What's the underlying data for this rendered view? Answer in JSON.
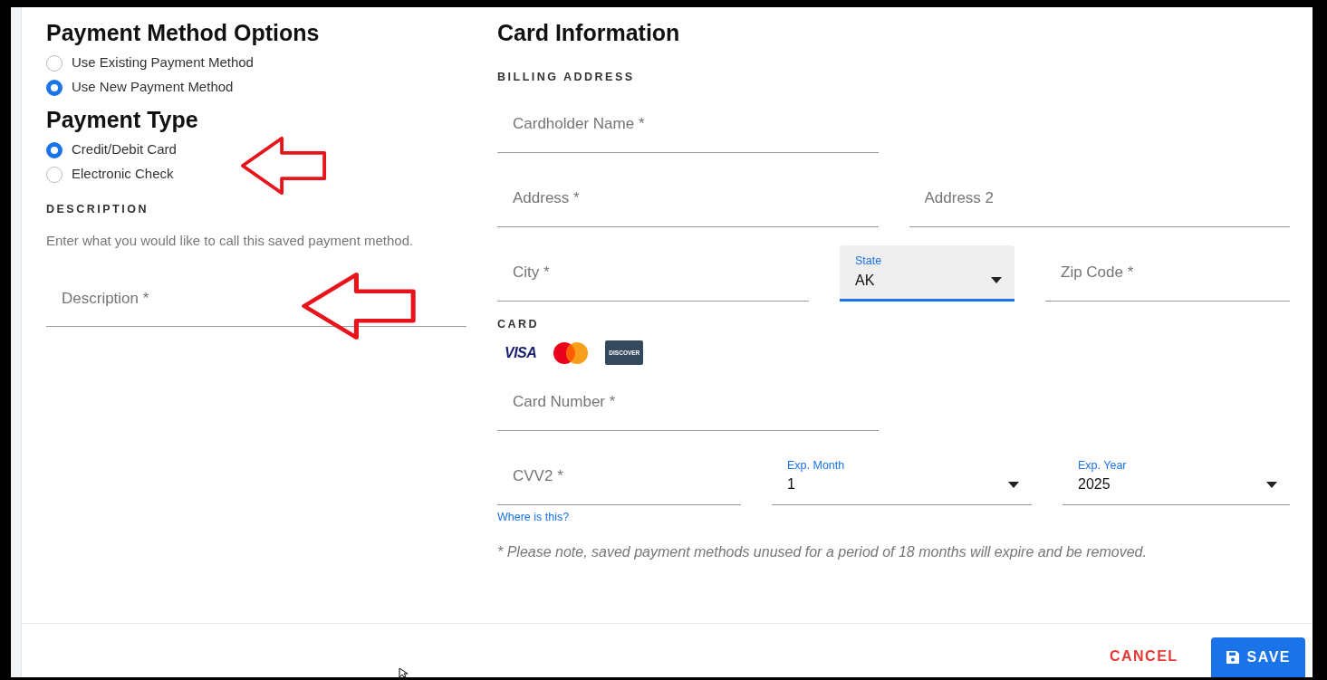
{
  "payment_options": {
    "title": "Payment Method Options",
    "options": [
      {
        "label": "Use Existing Payment Method",
        "selected": false
      },
      {
        "label": "Use New Payment Method",
        "selected": true
      }
    ]
  },
  "payment_type": {
    "title": "Payment Type",
    "options": [
      {
        "label": "Credit/Debit Card",
        "selected": true
      },
      {
        "label": "Electronic Check",
        "selected": false
      }
    ]
  },
  "description": {
    "heading": "DESCRIPTION",
    "help": "Enter what you would like to call this saved payment method.",
    "placeholder": "Description *"
  },
  "card_information": {
    "title": "Card Information",
    "billing_heading": "BILLING ADDRESS",
    "billing_rows": [
      [
        {
          "kind": "input",
          "placeholder": "Cardholder Name *"
        }
      ],
      [
        {
          "kind": "input",
          "placeholder": "Address *"
        },
        {
          "kind": "input",
          "placeholder": "Address 2"
        }
      ],
      [
        {
          "kind": "input",
          "placeholder": "City *"
        },
        {
          "kind": "select",
          "label": "State",
          "value": "AK",
          "focused": true
        },
        {
          "kind": "input",
          "placeholder": "Zip Code *"
        }
      ]
    ],
    "card_heading": "CARD",
    "card_brands": [
      {
        "kind": "visa",
        "label": "VISA"
      },
      {
        "kind": "mastercard"
      },
      {
        "kind": "discover",
        "label": "DISCOVER"
      }
    ],
    "card_rows": [
      [
        {
          "kind": "input",
          "placeholder": "Card Number *"
        }
      ],
      [
        {
          "kind": "input",
          "placeholder": "CVV2 *",
          "help_link": "Where is this?"
        },
        {
          "kind": "select",
          "label": "Exp. Month",
          "value": "1",
          "focused": false
        },
        {
          "kind": "select",
          "label": "Exp. Year",
          "value": "2025",
          "focused": false
        }
      ]
    ],
    "note": "* Please note, saved payment methods unused for a period of 18 months will expire and be removed."
  },
  "footer": {
    "cancel": "CANCEL",
    "save": "SAVE"
  }
}
